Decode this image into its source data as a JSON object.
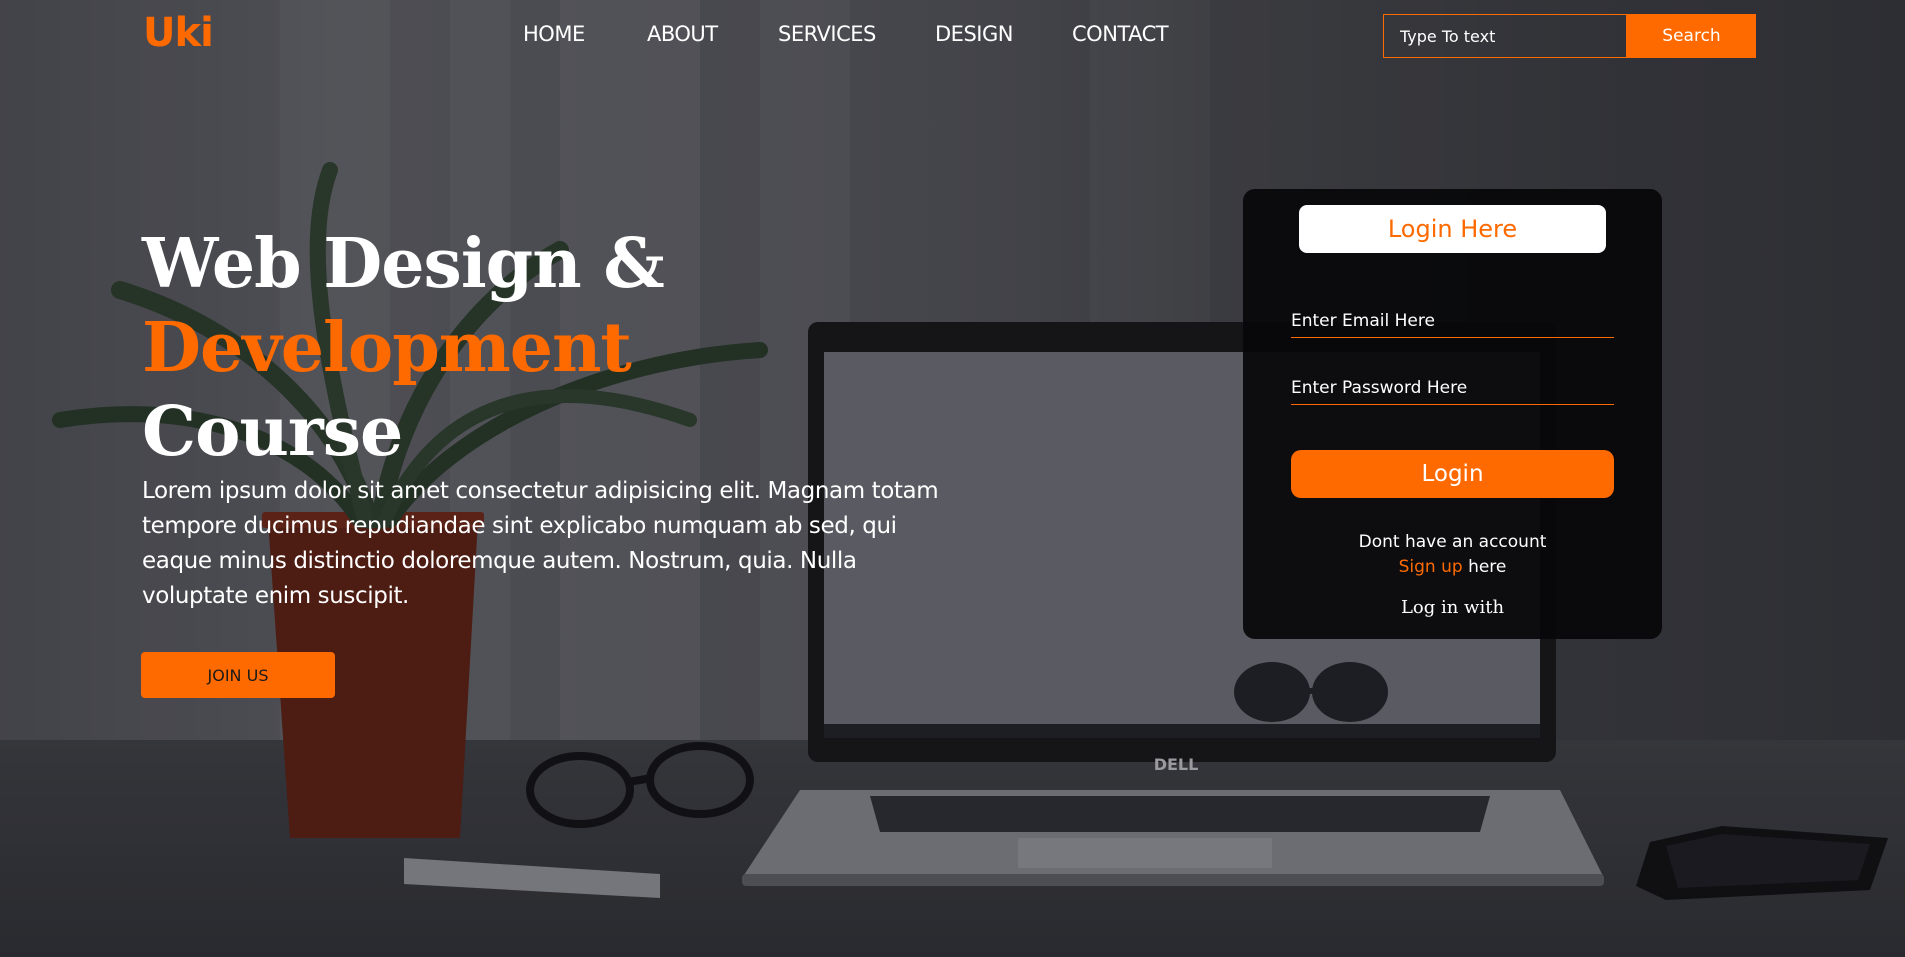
{
  "brand": {
    "logo": "Uki",
    "accent_color": "#ff6a00"
  },
  "nav": {
    "items": [
      {
        "label": "HOME"
      },
      {
        "label": "ABOUT"
      },
      {
        "label": "SERVICES"
      },
      {
        "label": "DESIGN"
      },
      {
        "label": "CONTACT"
      }
    ]
  },
  "search": {
    "placeholder": "Type To text",
    "button_label": "Search"
  },
  "hero": {
    "title_line1": "Web Design &",
    "title_line2": "Development",
    "title_line3": "Course",
    "paragraph": "Lorem ipsum dolor sit amet consectetur adipisicing elit. Magnam totam tempore ducimus repudiandae sint explicabo numquam ab sed, qui eaque minus distinctio doloremque autem. Nostrum, quia. Nulla voluptate enim suscipit.",
    "cta_label": "JOIN US"
  },
  "login": {
    "title": "Login Here",
    "email_placeholder": "Enter Email Here",
    "password_placeholder": "Enter Password Here",
    "button_label": "Login",
    "no_account_text": "Dont have an account",
    "signup_link": "Sign up",
    "signup_suffix": " here",
    "login_with": "Log in with"
  }
}
